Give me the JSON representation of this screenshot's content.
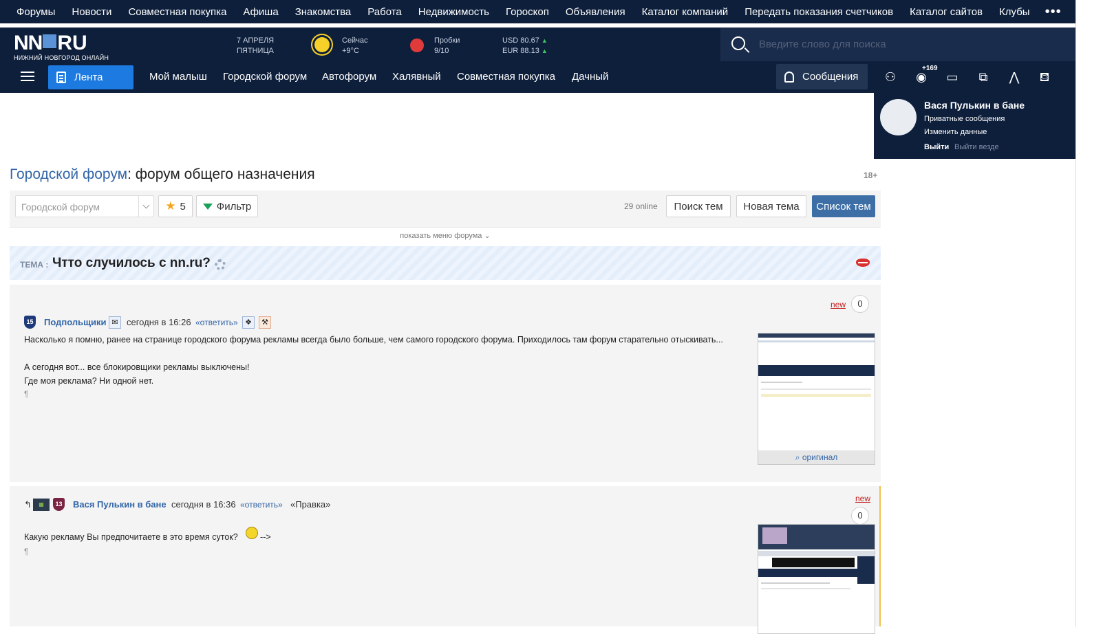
{
  "topnav": {
    "items": [
      "Форумы",
      "Новости",
      "Совместная покупка",
      "Афиша",
      "Знакомства",
      "Работа",
      "Недвижимость",
      "Гороскоп",
      "Объявления",
      "Каталог компаний",
      "Передать показания счетчиков",
      "Каталог сайтов",
      "Клубы"
    ],
    "more": "•••"
  },
  "header": {
    "logo_main": "NN",
    "logo_ru": "RU",
    "logo_sub": "НИЖНИЙ НОВГОРОД ОНЛАЙН",
    "date_line1": "7 АПРЕЛЯ",
    "date_line2": "ПЯТНИЦА",
    "weather_label": "Сейчас",
    "weather_value": "+9°C",
    "traffic_label": "Пробки",
    "traffic_value": "9/10",
    "usd": "USD 80.67",
    "eur": "EUR 88.13",
    "search_placeholder": "Введите слово для поиска"
  },
  "subnav": {
    "feed": "Лента",
    "items": [
      "Мой малыш",
      "Городской форум",
      "Автофорум",
      "Халявный",
      "Совместная покупка",
      "Дачный"
    ],
    "messages": "Сообщения",
    "views_badge": "+169"
  },
  "user": {
    "name": "Вася Пулькин в бане",
    "private_messages": "Приватные сообщения",
    "edit_profile": "Изменить данные",
    "logout": "Выйти",
    "logout_all": "Выйти везде"
  },
  "page": {
    "title_link": "Городской форум",
    "title_rest": ": форум общего назначения",
    "age": "18+"
  },
  "toolbar": {
    "forum_placeholder": "Городской форум",
    "stars": "5",
    "filter": "Фильтр",
    "online": "29 online",
    "search_topics": "Поиск тем",
    "new_topic": "Новая тема",
    "topic_list": "Список тем",
    "show_menu": "показать меню форума"
  },
  "topic": {
    "label": "ТЕМА :",
    "title": "Чтто случилось с nn.ru?"
  },
  "posts": [
    {
      "level": "15",
      "author": "Подпольщики",
      "time": "сегодня в 16:26",
      "reply": "«ответить»",
      "new": "new",
      "count": "0",
      "lines": [
        "Насколько я помню, ранее на странице городского форума рекламы всегда было больше, чем самого городского форума. Приходилось там форум старательно отыскивать...",
        "",
        "А сегодня вот... все блокировщики рекламы выключены!",
        "Где моя реклама? Ни одной нет."
      ],
      "pilcrow": "¶",
      "thumb_caption": "оригинал"
    },
    {
      "level": "13",
      "author": "Вася Пулькин в бане",
      "time": "сегодня в 16:36",
      "reply": "«ответить»",
      "edit": "«Правка»",
      "new": "new",
      "count": "0",
      "lines": [
        "Какую рекламу Вы предпочитаете в это время суток?"
      ],
      "after_smiley": "-->",
      "pilcrow": "¶"
    }
  ],
  "colors": {
    "nav_bg": "#0e1f3b",
    "accent": "#1c7ae0",
    "link": "#3366a8",
    "new": "#c0201e"
  }
}
